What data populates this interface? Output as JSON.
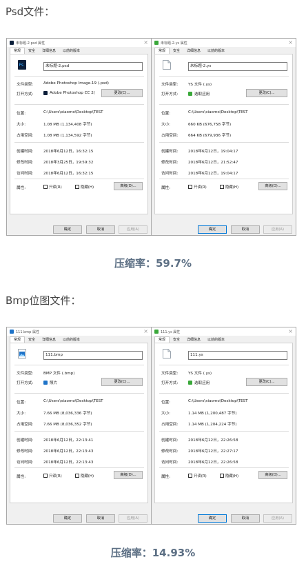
{
  "heading1": "Psd文件：",
  "ratio1": "压缩率：59.7%",
  "heading2": "Bmp位图文件：",
  "ratio2": "压缩率：14.93%",
  "labels": {
    "file_type": "文件类型:",
    "open_with": "打开方式:",
    "location": "位置:",
    "size": "大小:",
    "size_on_disk": "占用空间:",
    "created": "创建时间:",
    "modified": "修改时间:",
    "accessed": "访问时间:",
    "attributes": "属性:",
    "readonly": "只读(R)",
    "hidden": "隐藏(H)",
    "advanced": "高级(D)...",
    "change": "更改(C)...",
    "ok": "确定",
    "cancel": "取消",
    "apply": "应用(A)"
  },
  "windows": [
    {
      "title": "未标题-2.psd 属性",
      "tabs": [
        "常规",
        "安全",
        "详细信息",
        "以前的版本"
      ],
      "filename": "未标题-2.psd",
      "file_type": "Adobe Photoshop Image.19 (.psd)",
      "open_with": "Adobe Photoshop CC 2(",
      "location": "C:\\Users\\xiaomo\\Desktop\\TEST",
      "size": "1.08 MB (1,134,408 字节)",
      "size_on_disk": "1.08 MB (1,134,592 字节)",
      "created": "2018年6月12日，16:32:15",
      "modified": "2018年3月25日，19:59:32",
      "accessed": "2018年6月12日，16:32:15",
      "icon": "psd-file-icon",
      "accent": "#0b1f3a"
    },
    {
      "title": "未标题-2.ys 属性",
      "tabs": [
        "常规",
        "安全",
        "详细信息",
        "以前的版本"
      ],
      "filename": "未标题-2.ys",
      "file_type": "YS 文件 (.ys)",
      "open_with": "选取应用",
      "location": "C:\\Users\\xiaomo\\Desktop\\TEST",
      "size": "660 KB (676,758 字节)",
      "size_on_disk": "664 KB (679,936 字节)",
      "created": "2018年6月12日，19:04:17",
      "modified": "2018年6月12日，21:52:47",
      "accessed": "2018年6月12日，19:04:17",
      "icon": "blank-file-icon",
      "accent": "#3aa83a"
    },
    {
      "title": "111.bmp 属性",
      "tabs": [
        "常规",
        "安全",
        "详细信息",
        "以前的版本"
      ],
      "filename": "111.bmp",
      "file_type": "BMP 文件 (.bmp)",
      "open_with": "照片",
      "location": "C:\\Users\\xiaomo\\Desktop\\TEST",
      "size": "7.66 MB (8,036,336 字节)",
      "size_on_disk": "7.66 MB (8,036,352 字节)",
      "created": "2018年6月12日，22:13:41",
      "modified": "2018年6月12日，22:13:43",
      "accessed": "2018年6月12日，22:13:43",
      "icon": "bmp-file-icon",
      "accent": "#1e73c8"
    },
    {
      "title": "111.ys 属性",
      "tabs": [
        "常规",
        "安全",
        "详细信息",
        "以前的版本"
      ],
      "filename": "111.ys",
      "file_type": "YS 文件 (.ys)",
      "open_with": "选取应用",
      "location": "C:\\Users\\xiaomo\\Desktop\\TEST",
      "size": "1.14 MB (1,200,487 字节)",
      "size_on_disk": "1.14 MB (1,204,224 字节)",
      "created": "2018年6月12日，22:26:58",
      "modified": "2018年6月12日，22:27:17",
      "accessed": "2018年6月12日，22:26:58",
      "icon": "blank-file-icon",
      "accent": "#3aa83a"
    }
  ]
}
